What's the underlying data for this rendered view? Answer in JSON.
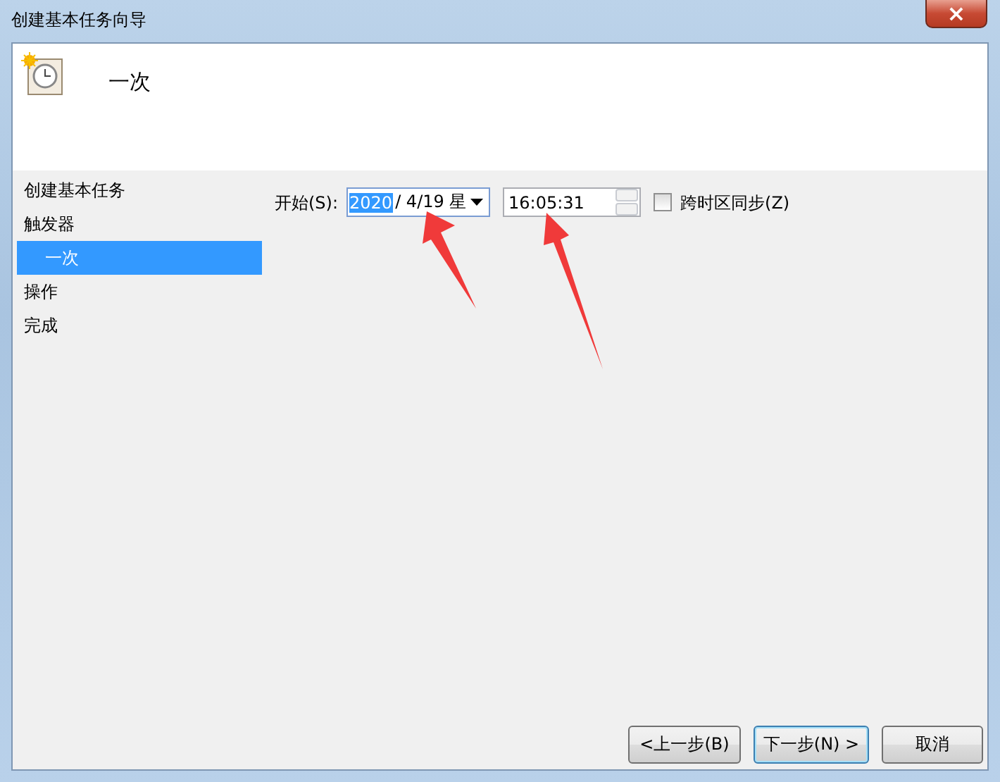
{
  "window": {
    "title": "创建基本任务向导",
    "close": "×"
  },
  "header": {
    "title": "一次"
  },
  "sidebar": {
    "items": [
      {
        "label": "创建基本任务",
        "selected": false
      },
      {
        "label": "触发器",
        "selected": false,
        "children": [
          {
            "label": "一次",
            "selected": true
          }
        ]
      },
      {
        "label": "操作",
        "selected": false
      },
      {
        "label": "完成",
        "selected": false
      }
    ]
  },
  "form": {
    "start_label": "开始(S):",
    "date_year": "2020",
    "date_rest": "/  4/19 星",
    "time": "16:05:31",
    "sync_label": "跨时区同步(Z)",
    "sync_checked": false
  },
  "buttons": [
    {
      "label": "<上一步(B)",
      "focused": false
    },
    {
      "label": "下一步(N) >",
      "focused": true
    },
    {
      "label": "取消",
      "focused": false
    }
  ]
}
